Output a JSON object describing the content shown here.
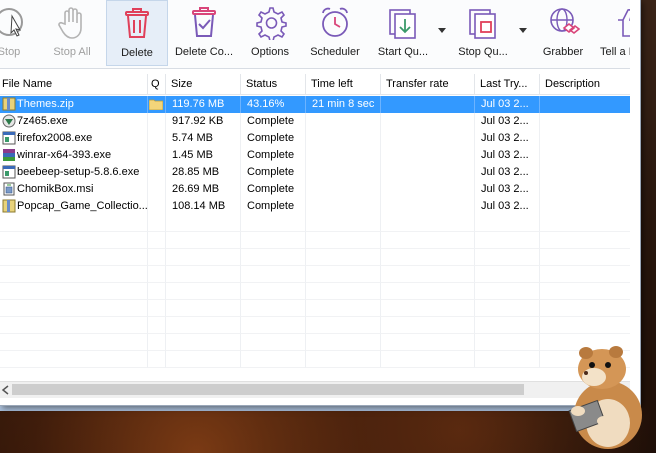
{
  "toolbar": {
    "buttons": [
      {
        "label": "Stop"
      },
      {
        "label": "Stop All"
      },
      {
        "label": "Delete"
      },
      {
        "label": "Delete Co..."
      },
      {
        "label": "Options"
      },
      {
        "label": "Scheduler"
      },
      {
        "label": "Start Qu..."
      },
      {
        "label": "Stop Qu..."
      },
      {
        "label": "Grabber"
      },
      {
        "label": "Tell a Fri"
      }
    ]
  },
  "table": {
    "columns": [
      "File Name",
      "Q",
      "Size",
      "Status",
      "Time left",
      "Transfer rate",
      "Last Try...",
      "Description"
    ],
    "rows": [
      {
        "name": "Themes.zip",
        "q": "",
        "size": "119.76  MB",
        "status": "43.16%",
        "time_left": "21 min 8 sec",
        "rate": "",
        "last_try": "Jul 03 2...",
        "desc": "",
        "icon": "zip-archive-icon"
      },
      {
        "name": "7z465.exe",
        "q": "",
        "size": "917.92  KB",
        "status": "Complete",
        "time_left": "",
        "rate": "",
        "last_try": "Jul 03 2...",
        "desc": "",
        "icon": "7zip-installer-icon"
      },
      {
        "name": "firefox2008.exe",
        "q": "",
        "size": "5.74  MB",
        "status": "Complete",
        "time_left": "",
        "rate": "",
        "last_try": "Jul 03 2...",
        "desc": "",
        "icon": "exe-application-icon"
      },
      {
        "name": "winrar-x64-393.exe",
        "q": "",
        "size": "1.45  MB",
        "status": "Complete",
        "time_left": "",
        "rate": "",
        "last_try": "Jul 03 2...",
        "desc": "",
        "icon": "winrar-icon"
      },
      {
        "name": "beebeep-setup-5.8.6.exe",
        "q": "",
        "size": "28.85  MB",
        "status": "Complete",
        "time_left": "",
        "rate": "",
        "last_try": "Jul 03 2...",
        "desc": "",
        "icon": "exe-application-icon"
      },
      {
        "name": "ChomikBox.msi",
        "q": "",
        "size": "26.69  MB",
        "status": "Complete",
        "time_left": "",
        "rate": "",
        "last_try": "Jul 03 2...",
        "desc": "",
        "icon": "msi-installer-icon"
      },
      {
        "name": "Popcap_Game_Collectio...",
        "q": "",
        "size": "108.14  MB",
        "status": "Complete",
        "time_left": "",
        "rate": "",
        "last_try": "Jul 03 2...",
        "desc": "",
        "icon": "zip-archive-icon"
      }
    ]
  },
  "colors": {
    "selection": "#3399ff",
    "delete_red": "#e0405a",
    "icon_purple": "#7a5ab8",
    "accent_pink": "#d9457a"
  }
}
